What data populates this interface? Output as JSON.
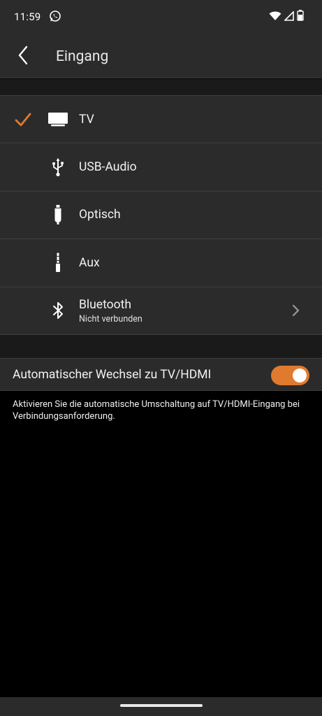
{
  "status_bar": {
    "time": "11:59",
    "icons": [
      "whatsapp-icon",
      "wifi-icon",
      "signal-icon",
      "battery-icon"
    ]
  },
  "header": {
    "back_icon": "chevron-left-icon",
    "title": "Eingang"
  },
  "inputs": [
    {
      "label": "TV",
      "icon": "tv-icon",
      "selected": true
    },
    {
      "label": "USB-Audio",
      "icon": "usb-icon",
      "selected": false
    },
    {
      "label": "Optisch",
      "icon": "optical-icon",
      "selected": false
    },
    {
      "label": "Aux",
      "icon": "aux-jack-icon",
      "selected": false
    },
    {
      "label": "Bluetooth",
      "sublabel": "Nicht verbunden",
      "icon": "bluetooth-icon",
      "selected": false,
      "has_chevron": true
    }
  ],
  "auto_switch": {
    "label": "Automatischer Wechsel zu TV/HDMI",
    "enabled": true,
    "description": "Aktivieren Sie die automatische Umschaltung auf TV/HDMI-Eingang bei Verbindungsanforderung."
  },
  "colors": {
    "accent": "#e07a2e",
    "surface": "#2b2b2b",
    "background": "#000000"
  }
}
